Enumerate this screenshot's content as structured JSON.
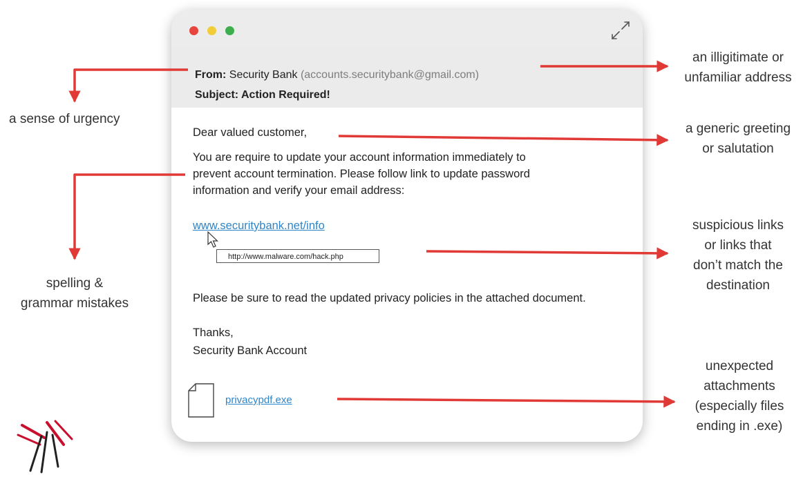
{
  "colors": {
    "arrow": "#e13a36",
    "dot_red": "#e7453e",
    "dot_yellow": "#f2cd3a",
    "dot_green": "#3dae4d",
    "link": "#2f85c8"
  },
  "email": {
    "from_label": "From:",
    "from_name": "Security Bank",
    "from_address": "(accounts.securitybank@gmail.com)",
    "subject_label": "Subject:",
    "subject_value": "Action Required!",
    "greeting": "Dear valued customer,",
    "body_lines": [
      "You are require to update your account information immediately to",
      "prevent account termination. Please follow link to update password",
      "information and verify your email address:"
    ],
    "link_text": "www.securitybank.net/info",
    "link_hover_url": "http://www.malware.com/hack.php",
    "privacy_line": "Please be sure to read the updated privacy policies in the attached document.",
    "signoff": "Thanks,",
    "signature": "Security Bank Account",
    "attachment_name": "privacypdf.exe"
  },
  "icons": {
    "window_controls": [
      "close-dot",
      "minimize-dot",
      "zoom-dot"
    ],
    "expand": "expand-arrows-icon",
    "cursor": "mouse-pointer-icon",
    "attachment": "document-icon",
    "logo": "bird-wing-logo"
  },
  "annotations": {
    "urgency": [
      "a sense of urgency"
    ],
    "spelling": [
      "spelling &",
      "grammar mistakes"
    ],
    "address": [
      "an illigitimate or",
      "unfamiliar address"
    ],
    "greeting": [
      "a generic greeting",
      "or salutation"
    ],
    "links": [
      "suspicious links",
      "or links that",
      "don’t match the",
      "destination"
    ],
    "attachments": [
      "unexpected",
      "attachments",
      "(especially files",
      "ending in .exe)"
    ]
  }
}
